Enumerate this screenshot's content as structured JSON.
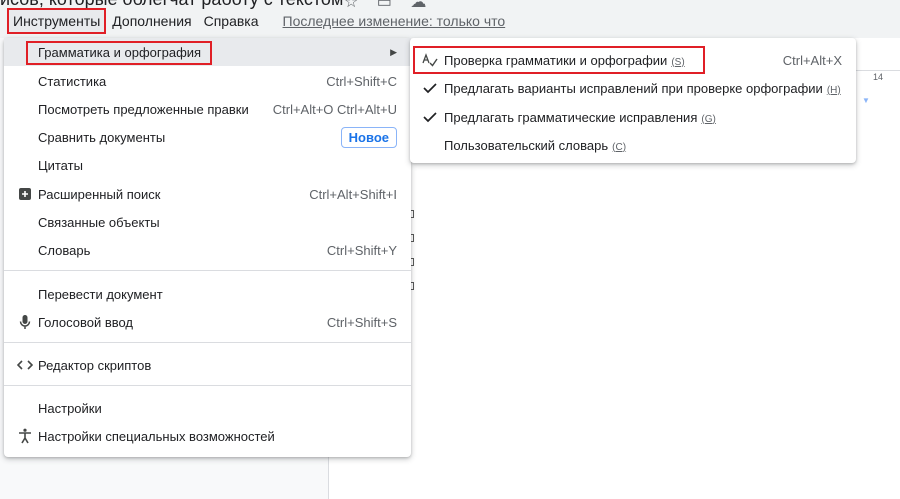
{
  "header": {
    "doc_title": "исов, которые облегчат работу с текстом",
    "icons": [
      "star-icon",
      "move-icon",
      "cloud-icon"
    ]
  },
  "menubar": {
    "items": [
      {
        "label": "Инструменты",
        "active": true
      },
      {
        "label": "Дополнения"
      },
      {
        "label": "Справка"
      }
    ],
    "last_change": "Последнее изменение: только что"
  },
  "ruler": {
    "mark": "14"
  },
  "menu": {
    "items": [
      {
        "label": "Грамматика и орфография",
        "has_submenu": true,
        "highlighted": true
      },
      {
        "label": "Статистика",
        "shortcut": "Ctrl+Shift+C"
      },
      {
        "label": "Посмотреть предложенные правки",
        "shortcut": "Ctrl+Alt+O Ctrl+Alt+U"
      },
      {
        "label": "Сравнить документы",
        "badge": "Новое"
      },
      {
        "label": "Цитаты"
      },
      {
        "label": "Расширенный поиск",
        "shortcut": "Ctrl+Alt+Shift+I",
        "icon": "plus-box-icon"
      },
      {
        "label": "Связанные объекты"
      },
      {
        "label": "Словарь",
        "shortcut": "Ctrl+Shift+Y"
      },
      {
        "label": "Перевести документ"
      },
      {
        "label": "Голосовой ввод",
        "shortcut": "Ctrl+Shift+S",
        "icon": "microphone-icon"
      },
      {
        "label": "Редактор скриптов",
        "icon": "code-icon"
      },
      {
        "label": "Настройки"
      },
      {
        "label": "Настройки специальных возможностей",
        "icon": "accessibility-icon"
      }
    ]
  },
  "submenu": {
    "items": [
      {
        "label": "Проверка грамматики и орфографии",
        "mnemonic": "(S)",
        "shortcut": "Ctrl+Alt+X",
        "icon": "spellcheck-icon"
      },
      {
        "label": "Предлагать варианты исправлений при проверке орфографии",
        "mnemonic": "(H)",
        "checked": true
      },
      {
        "label": "Предлагать грамматические исправления",
        "mnemonic": "(G)",
        "checked": true
      },
      {
        "label": "Пользовательский словарь",
        "mnemonic": "(C)"
      }
    ]
  },
  "colors": {
    "highlight_outline": "#e01f26",
    "badge_blue": "#1a73e8"
  }
}
